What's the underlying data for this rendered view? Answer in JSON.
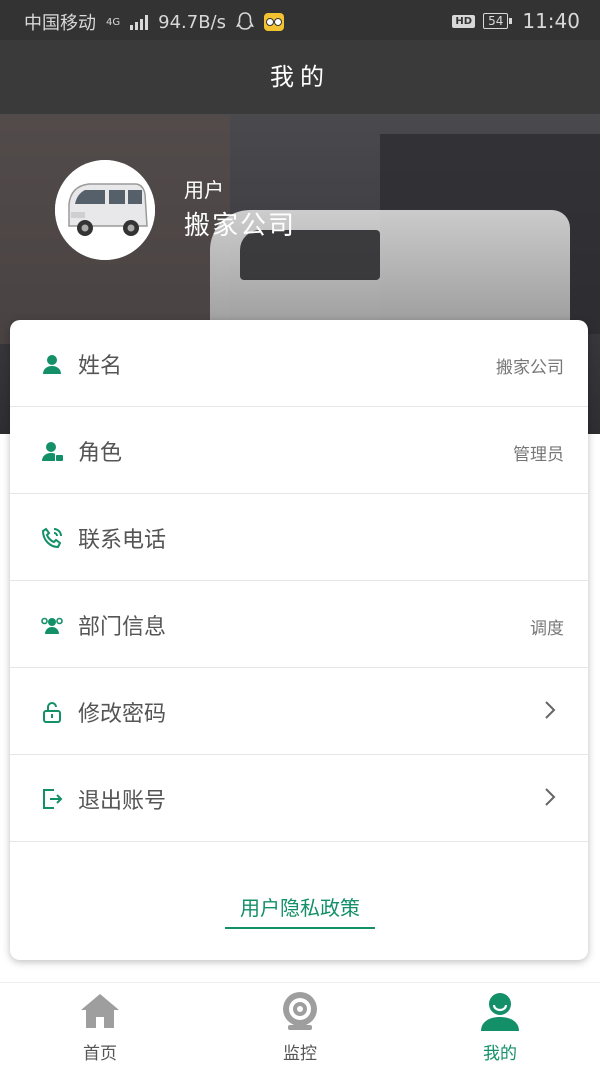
{
  "status_bar": {
    "carrier": "中国移动",
    "network": "4G",
    "speed": "94.7B/s",
    "hd": "HD",
    "battery": "54",
    "time": "11:40"
  },
  "header": {
    "title": "我的"
  },
  "profile": {
    "role_label": "用户",
    "name": "搬家公司"
  },
  "menu": [
    {
      "label": "姓名",
      "value": "搬家公司",
      "icon": "person-icon"
    },
    {
      "label": "角色",
      "value": "管理员",
      "icon": "user-role-icon"
    },
    {
      "label": "联系电话",
      "value": "",
      "icon": "phone-icon"
    },
    {
      "label": "部门信息",
      "value": "调度",
      "icon": "group-icon"
    },
    {
      "label": "修改密码",
      "value": "",
      "icon": "lock-icon"
    },
    {
      "label": "退出账号",
      "value": "",
      "icon": "logout-icon"
    }
  ],
  "privacy_link": "用户隐私政策",
  "bottom_nav": [
    {
      "label": "首页",
      "icon": "home-icon",
      "active": false
    },
    {
      "label": "监控",
      "icon": "camera-icon",
      "active": false
    },
    {
      "label": "我的",
      "icon": "profile-icon",
      "active": true
    }
  ],
  "colors": {
    "accent": "#139068",
    "header": "#3a3a3a"
  }
}
